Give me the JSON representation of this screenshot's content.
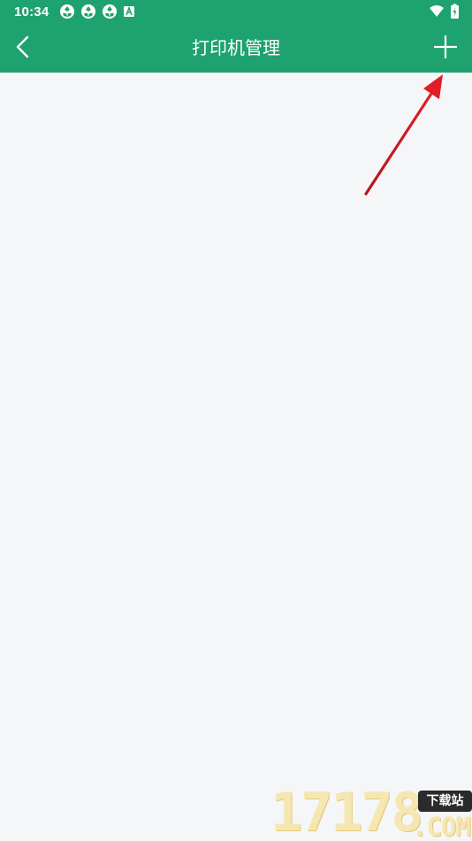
{
  "status_bar": {
    "time": "10:34",
    "notification_icons": [
      "app-notification-icon",
      "app-notification-icon",
      "app-notification-icon",
      "a-badge-icon"
    ],
    "right_icons": [
      "wifi-icon",
      "battery-charging-icon"
    ],
    "background_color": "#1ea26f"
  },
  "app_bar": {
    "title": "打印机管理",
    "back_icon": "chevron-left-icon",
    "add_icon": "plus-icon",
    "background_color": "#1ea26f",
    "foreground_color": "#ffffff"
  },
  "content": {
    "background_color": "#f5f6f7"
  },
  "annotation": {
    "icon": "red-arrow-icon",
    "color": "#d7191f"
  },
  "watermark": {
    "number": "17178",
    "badge": "下载站",
    "domain": ".COM"
  }
}
